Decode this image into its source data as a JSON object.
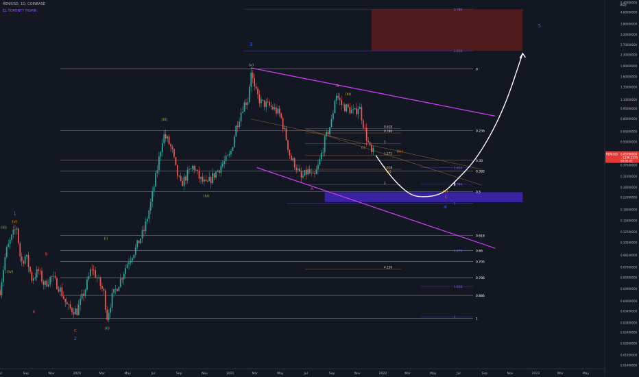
{
  "header": {
    "symbol_line": "REN/USD, 1D, COINBASE",
    "indicator_line": "EL TOPONTY FIGPIN"
  },
  "currency_label": "USD",
  "price_tag": {
    "symbol": "RENUSD",
    "value": "0.45766000",
    "change": "−1296.1375",
    "timer": "04:05:01"
  },
  "colors": {
    "background": "#131722",
    "candle_up": "#26a69a",
    "candle_down": "#ef5350",
    "channel": "#c83cf0",
    "fib_line": "#b8b8b8",
    "fib_orange": "#d28c3c",
    "target_box": "#5c1a1a",
    "support_box": "#4a2ad8",
    "projection_arrow": "#ffffff",
    "wave_primary": "#2962ff",
    "wave_intermediate": "#ef5350",
    "wave_minor": "#8bc34a",
    "wave_sub": "#ff9800"
  },
  "chart_data": {
    "type": "candlestick",
    "scale": "log",
    "ylim": [
      0.0135,
      5.4
    ],
    "xlim": [
      "2019-07-01",
      "2023-06-15"
    ],
    "x_ticks": [
      {
        "date": "2019-07-01",
        "label": "Jul"
      },
      {
        "date": "2019-09-01",
        "label": "Sep"
      },
      {
        "date": "2019-11-01",
        "label": "Nov"
      },
      {
        "date": "2020-01-01",
        "label": "2020"
      },
      {
        "date": "2020-03-01",
        "label": "Mar"
      },
      {
        "date": "2020-05-01",
        "label": "May"
      },
      {
        "date": "2020-07-01",
        "label": "Jul"
      },
      {
        "date": "2020-09-01",
        "label": "Sep"
      },
      {
        "date": "2020-11-01",
        "label": "Nov"
      },
      {
        "date": "2021-01-01",
        "label": "2021"
      },
      {
        "date": "2021-03-01",
        "label": "Mar"
      },
      {
        "date": "2021-05-01",
        "label": "May"
      },
      {
        "date": "2021-07-01",
        "label": "Jul"
      },
      {
        "date": "2021-09-01",
        "label": "Sep"
      },
      {
        "date": "2021-11-01",
        "label": "Nov"
      },
      {
        "date": "2022-01-01",
        "label": "2022"
      },
      {
        "date": "2022-03-01",
        "label": "Mar"
      },
      {
        "date": "2022-05-01",
        "label": "May"
      },
      {
        "date": "2022-07-01",
        "label": "Jul"
      },
      {
        "date": "2022-09-01",
        "label": "Sep"
      },
      {
        "date": "2022-11-01",
        "label": "Nov"
      },
      {
        "date": "2023-01-01",
        "label": "2023"
      },
      {
        "date": "2023-03-01",
        "label": "Mar"
      },
      {
        "date": "2023-05-01",
        "label": "May"
      }
    ],
    "y_ticks": [
      {
        "value": 5.4,
        "label": "5.40000000"
      },
      {
        "value": 4.6,
        "label": "4.60000000"
      },
      {
        "value": 3.8,
        "label": "3.80000000"
      },
      {
        "value": 3.2,
        "label": "3.20000000"
      },
      {
        "value": 2.7,
        "label": "2.70000000"
      },
      {
        "value": 2.3,
        "label": "2.30000000"
      },
      {
        "value": 1.9,
        "label": "1.90000000"
      },
      {
        "value": 1.6,
        "label": "1.60000000"
      },
      {
        "value": 1.35,
        "label": "1.35000000"
      },
      {
        "value": 1.1,
        "label": "1.10000000"
      },
      {
        "value": 0.95,
        "label": "0.95000000"
      },
      {
        "value": 0.8,
        "label": "0.80000000"
      },
      {
        "value": 0.65,
        "label": "0.65000000"
      },
      {
        "value": 0.55,
        "label": "0.55000000"
      },
      {
        "value": 0.45,
        "label": "0.45000000"
      },
      {
        "value": 0.375,
        "label": "0.37500000"
      },
      {
        "value": 0.31,
        "label": "0.31000000"
      },
      {
        "value": 0.26,
        "label": "0.26000000"
      },
      {
        "value": 0.22,
        "label": "0.22000000"
      },
      {
        "value": 0.18,
        "label": "0.18000000"
      },
      {
        "value": 0.15,
        "label": "0.15000000"
      },
      {
        "value": 0.125,
        "label": "0.12500000"
      },
      {
        "value": 0.105,
        "label": "0.10500000"
      },
      {
        "value": 0.085,
        "label": "0.08500000"
      },
      {
        "value": 0.07,
        "label": "0.07000000"
      },
      {
        "value": 0.059,
        "label": "0.05900000"
      },
      {
        "value": 0.049,
        "label": "0.04900000"
      },
      {
        "value": 0.04,
        "label": "0.04000000"
      },
      {
        "value": 0.034,
        "label": "0.03400000"
      },
      {
        "value": 0.028,
        "label": "0.02800000"
      },
      {
        "value": 0.024,
        "label": "0.02400000"
      },
      {
        "value": 0.02,
        "label": "0.02000000"
      },
      {
        "value": 0.0165,
        "label": "0.01650000"
      },
      {
        "value": 0.014,
        "label": "0.01400000"
      }
    ],
    "price_path": [
      [
        "2019-07-01",
        0.048
      ],
      [
        "2019-07-15",
        0.09
      ],
      [
        "2019-08-01",
        0.12
      ],
      [
        "2019-08-10",
        0.135
      ],
      [
        "2019-08-20",
        0.075
      ],
      [
        "2019-09-01",
        0.085
      ],
      [
        "2019-09-15",
        0.058
      ],
      [
        "2019-10-01",
        0.066
      ],
      [
        "2019-10-15",
        0.052
      ],
      [
        "2019-11-01",
        0.06
      ],
      [
        "2019-11-20",
        0.05
      ],
      [
        "2019-12-10",
        0.036
      ],
      [
        "2020-01-01",
        0.034
      ],
      [
        "2020-01-20",
        0.048
      ],
      [
        "2020-02-05",
        0.07
      ],
      [
        "2020-02-20",
        0.057
      ],
      [
        "2020-03-05",
        0.046
      ],
      [
        "2020-03-13",
        0.031
      ],
      [
        "2020-03-25",
        0.043
      ],
      [
        "2020-04-15",
        0.058
      ],
      [
        "2020-05-01",
        0.076
      ],
      [
        "2020-05-20",
        0.095
      ],
      [
        "2020-06-10",
        0.13
      ],
      [
        "2020-06-25",
        0.2
      ],
      [
        "2020-07-10",
        0.34
      ],
      [
        "2020-07-25",
        0.62
      ],
      [
        "2020-08-05",
        0.56
      ],
      [
        "2020-08-15",
        0.48
      ],
      [
        "2020-08-25",
        0.34
      ],
      [
        "2020-09-05",
        0.27
      ],
      [
        "2020-09-20",
        0.32
      ],
      [
        "2020-10-05",
        0.37
      ],
      [
        "2020-10-20",
        0.3
      ],
      [
        "2020-11-05",
        0.27
      ],
      [
        "2020-11-20",
        0.31
      ],
      [
        "2020-12-10",
        0.37
      ],
      [
        "2021-01-01",
        0.44
      ],
      [
        "2021-01-15",
        0.7
      ],
      [
        "2021-02-01",
        1.0
      ],
      [
        "2021-02-12",
        1.1
      ],
      [
        "2021-02-20",
        1.78
      ],
      [
        "2021-02-28",
        1.3
      ],
      [
        "2021-03-15",
        1.05
      ],
      [
        "2021-04-01",
        1.0
      ],
      [
        "2021-04-15",
        0.95
      ],
      [
        "2021-05-01",
        0.85
      ],
      [
        "2021-05-15",
        0.58
      ],
      [
        "2021-05-25",
        0.42
      ],
      [
        "2021-06-05",
        0.38
      ],
      [
        "2021-06-20",
        0.3
      ],
      [
        "2021-07-05",
        0.34
      ],
      [
        "2021-07-20",
        0.3
      ],
      [
        "2021-08-01",
        0.38
      ],
      [
        "2021-08-15",
        0.56
      ],
      [
        "2021-09-01",
        0.78
      ],
      [
        "2021-09-10",
        1.23
      ],
      [
        "2021-09-25",
        1.0
      ],
      [
        "2021-10-10",
        0.95
      ],
      [
        "2021-10-25",
        0.88
      ],
      [
        "2021-11-05",
        1.0
      ],
      [
        "2021-11-15",
        0.74
      ],
      [
        "2021-11-25",
        0.56
      ],
      [
        "2021-12-05",
        0.45
      ],
      [
        "2021-12-12",
        0.47
      ]
    ],
    "projection": [
      [
        "2021-12-15",
        0.44
      ],
      [
        "2022-01-15",
        0.32
      ],
      [
        "2022-03-01",
        0.235
      ],
      [
        "2022-04-01",
        0.22
      ],
      [
        "2022-05-20",
        0.23
      ],
      [
        "2022-06-20",
        0.28
      ],
      [
        "2022-08-15",
        0.42
      ],
      [
        "2022-10-15",
        0.9
      ],
      [
        "2022-12-01",
        2.35
      ]
    ],
    "channel": {
      "upper": [
        [
          "2021-02-20",
          1.85
        ],
        [
          "2022-12-01",
          0.82
        ]
      ],
      "lower": [
        [
          "2021-02-01",
          0.36
        ],
        [
          "2022-12-01",
          0.1
        ]
      ]
    },
    "diagonal_fan": [
      {
        "from": [
          "2021-02-20",
          0.8
        ],
        "to": [
          "2022-12-01",
          0.35
        ]
      },
      {
        "from": [
          "2021-07-01",
          0.68
        ],
        "to": [
          "2022-12-01",
          0.27
        ]
      }
    ],
    "fib_levels": [
      {
        "value": 1.82,
        "label": "0"
      },
      {
        "value": 0.662,
        "label": "0.236"
      },
      {
        "value": 0.406,
        "label": "0.33"
      },
      {
        "value": 0.34,
        "label": "0.382"
      },
      {
        "value": 0.242,
        "label": "0.5"
      },
      {
        "value": 0.118,
        "label": "0.618"
      },
      {
        "value": 0.092,
        "label": "0.66"
      },
      {
        "value": 0.077,
        "label": "0.705"
      },
      {
        "value": 0.059,
        "label": "0.786"
      },
      {
        "value": 0.044,
        "label": "0.886"
      },
      {
        "value": 0.0302,
        "label": "1"
      }
    ],
    "fib_extensions": [
      {
        "value": 0.685,
        "label": "0.618"
      },
      {
        "value": 0.635,
        "label": "0.786"
      },
      {
        "value": 0.535,
        "label": "1"
      },
      {
        "value": 0.44,
        "label": "1.272"
      },
      {
        "value": 0.35,
        "label": "1.618"
      },
      {
        "value": 0.272,
        "label": "2"
      },
      {
        "value": 0.068,
        "label": "4.236"
      }
    ],
    "violet_levels": [
      {
        "value": 4.85,
        "label": "3.786",
        "start": "2021-02-01"
      },
      {
        "value": 2.45,
        "label": "2.618",
        "start": "2021-02-01"
      },
      {
        "value": 0.36,
        "label": "1.618",
        "start": "2022-04-01"
      },
      {
        "value": 0.275,
        "label": "0.786",
        "start": "2022-04-01"
      },
      {
        "value": 0.2,
        "label": "1",
        "start": "2021-05-15"
      },
      {
        "value": 0.092,
        "label": "1.272",
        "start": "2022-04-01"
      },
      {
        "value": 0.051,
        "label": "1.618",
        "start": "2022-04-01"
      },
      {
        "value": 0.031,
        "label": "1",
        "start": "2022-04-01"
      }
    ],
    "target_box": {
      "x0": "2021-12-05",
      "x1": "2022-12-01",
      "y0": 2.45,
      "y1": 4.85
    },
    "support_box": {
      "x0": "2021-08-15",
      "x1": "2022-12-01",
      "y0": 0.204,
      "y1": 0.24
    },
    "wave_labels": [
      {
        "date": "2019-08-05",
        "value": 0.165,
        "text": "1",
        "role": "primary"
      },
      {
        "date": "2019-07-10",
        "value": 0.132,
        "text": "(iii)",
        "role": "minor"
      },
      {
        "date": "2019-08-05",
        "value": 0.145,
        "text": "(v)",
        "role": "sub"
      },
      {
        "date": "2019-07-25",
        "value": 0.064,
        "text": "(iv)",
        "role": "minor"
      },
      {
        "date": "2019-09-20",
        "value": 0.033,
        "text": "A",
        "role": "intermediate"
      },
      {
        "date": "2019-10-20",
        "value": 0.085,
        "text": "B",
        "role": "intermediate"
      },
      {
        "date": "2019-12-28",
        "value": 0.0242,
        "text": "C",
        "role": "intermediate"
      },
      {
        "date": "2019-12-28",
        "value": 0.0212,
        "text": "2",
        "role": "primary"
      },
      {
        "date": "2020-03-13",
        "value": 0.0252,
        "text": "(ii)",
        "role": "minor"
      },
      {
        "date": "2020-03-10",
        "value": 0.11,
        "text": "(i)",
        "role": "minor"
      },
      {
        "date": "2020-07-28",
        "value": 0.78,
        "text": "(iii)",
        "role": "minor"
      },
      {
        "date": "2020-11-05",
        "value": 0.222,
        "text": "(iv)",
        "role": "minor"
      },
      {
        "date": "2021-02-20",
        "value": 1.9,
        "text": "(v)",
        "role": "minor"
      },
      {
        "date": "2021-02-20",
        "value": 2.65,
        "text": "3",
        "role": "primary"
      },
      {
        "date": "2021-07-15",
        "value": 0.25,
        "text": "A",
        "role": "intermediate"
      },
      {
        "date": "2021-09-15",
        "value": 1.35,
        "text": "B",
        "role": "intermediate"
      },
      {
        "date": "2021-10-10",
        "value": 1.18,
        "text": "(iii)",
        "role": "sub"
      },
      {
        "date": "2021-11-15",
        "value": 0.49,
        "text": "(i)",
        "role": "sub"
      },
      {
        "date": "2022-01-15",
        "value": 0.33,
        "text": "(ii)",
        "role": "sub"
      },
      {
        "date": "2022-02-10",
        "value": 0.46,
        "text": "(iv)",
        "role": "sub"
      },
      {
        "date": "2022-05-30",
        "value": 0.24,
        "text": "(v)",
        "role": "sub"
      },
      {
        "date": "2022-06-01",
        "value": 0.218,
        "text": "C",
        "role": "intermediate"
      },
      {
        "date": "2022-05-30",
        "value": 0.183,
        "text": "4",
        "role": "primary"
      },
      {
        "date": "2023-01-10",
        "value": 3.6,
        "text": "5",
        "role": "primary"
      }
    ]
  }
}
